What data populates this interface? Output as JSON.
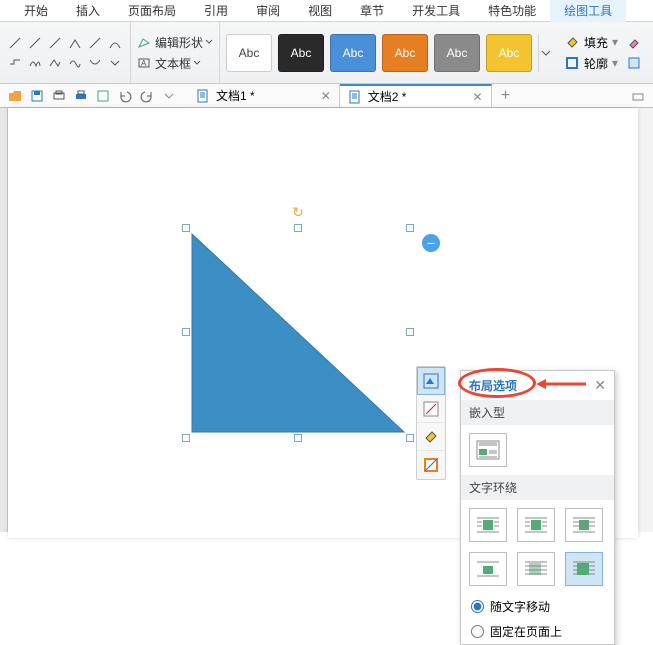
{
  "menu": {
    "items": [
      "开始",
      "插入",
      "页面布局",
      "引用",
      "审阅",
      "视图",
      "章节",
      "开发工具",
      "特色功能",
      "绘图工具"
    ],
    "active_index": 9
  },
  "ribbon": {
    "edit_shape": "编辑形状",
    "text_box": "文本框",
    "styles": [
      {
        "label": "Abc",
        "bg": "#ffffff",
        "text": "#444444"
      },
      {
        "label": "Abc",
        "bg": "#2a2a2a",
        "text": "#ffffff"
      },
      {
        "label": "Abc",
        "bg": "#4a90d9",
        "text": "#ffffff"
      },
      {
        "label": "Abc",
        "bg": "#e67e22",
        "text": "#ffffff"
      },
      {
        "label": "Abc",
        "bg": "#8a8a8a",
        "text": "#ffffff"
      },
      {
        "label": "Abc",
        "bg": "#f4c430",
        "text": "#ffffff"
      }
    ],
    "fill": "填充",
    "outline": "轮廓"
  },
  "tabs": {
    "docs": [
      {
        "name": "文档1 *"
      },
      {
        "name": "文档2 *"
      }
    ],
    "active_index": 1
  },
  "popup": {
    "title": "布局选项",
    "section_inline": "嵌入型",
    "section_wrap": "文字环绕",
    "radio_move": "随文字移动",
    "radio_fixed": "固定在页面上"
  }
}
